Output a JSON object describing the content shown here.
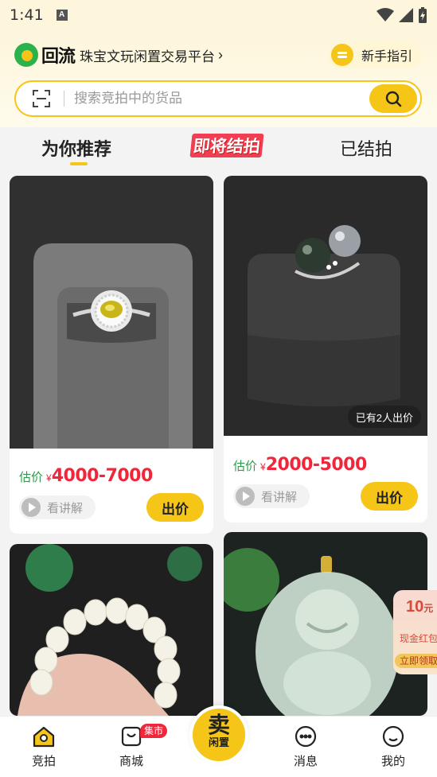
{
  "status_bar": {
    "time": "1:41",
    "a_icon": "A"
  },
  "header": {
    "logo_text": "回流",
    "platform_subtitle": "珠宝文玩闲置交易平台",
    "guide_label": "新手指引"
  },
  "search": {
    "placeholder": "搜索竞拍中的货品"
  },
  "tabs": [
    {
      "label": "为你推荐",
      "active": true
    },
    {
      "label": "即将结拍",
      "active": false
    },
    {
      "label": "已结拍",
      "active": false
    }
  ],
  "cards": [
    {
      "price_tag": "估价",
      "currency": "¥",
      "price": "4000-7000",
      "explain_label": "看讲解",
      "bid_label": "出价"
    },
    {
      "price_tag": "估价",
      "currency": "¥",
      "price": "2000-5000",
      "explain_label": "看讲解",
      "bid_label": "出价",
      "bidders_badge": "已有2人出价"
    }
  ],
  "coupon": {
    "amount": "10",
    "unit": "元",
    "text": "现金红包",
    "button": "立即领取"
  },
  "bottom_nav": {
    "items": [
      {
        "label": "竞拍",
        "icon": "auction-house-icon"
      },
      {
        "label": "商城",
        "icon": "shopping-bag-icon",
        "badge": "集市"
      },
      {
        "label": "消息",
        "icon": "message-icon"
      },
      {
        "label": "我的",
        "icon": "profile-icon"
      }
    ],
    "sell_main": "卖",
    "sell_sub": "闲置"
  },
  "colors": {
    "accent_yellow": "#f5c518",
    "price_red": "#f0263a",
    "estimate_green": "#2c9d4a"
  }
}
